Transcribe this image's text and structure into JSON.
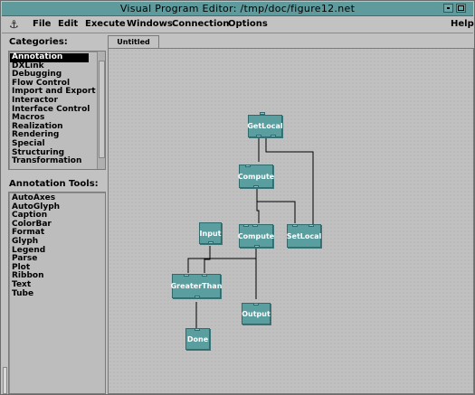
{
  "window": {
    "title": "Visual Program Editor: /tmp/doc/figure12.net"
  },
  "menu": {
    "file": "File",
    "edit": "Edit",
    "execute": "Execute",
    "windows": "Windows",
    "connection": "Connection",
    "options": "Options",
    "help": "Help"
  },
  "categories": {
    "label": "Categories:",
    "items": [
      "Annotation",
      "DXLink",
      "Debugging",
      "Flow Control",
      "Import and Export",
      "Interactor",
      "Interface Control",
      "Macros",
      "Realization",
      "Rendering",
      "Special",
      "Structuring",
      "Transformation"
    ],
    "selected": "Annotation"
  },
  "tools": {
    "label": "Annotation Tools:",
    "items": [
      "AutoAxes",
      "AutoGlyph",
      "Caption",
      "ColorBar",
      "Format",
      "Glyph",
      "Legend",
      "Parse",
      "Plot",
      "Ribbon",
      "Text",
      "Tube"
    ]
  },
  "tab": {
    "label": "Untitled"
  },
  "nodes": {
    "getlocal": "GetLocal",
    "compute1": "Compute",
    "input": "Input",
    "compute2": "Compute",
    "setlocal": "SetLocal",
    "greaterthan": "GreaterThan",
    "output": "Output",
    "done": "Done"
  },
  "colors": {
    "module": "#5a9ea0",
    "titlebar": "#5f9a9c"
  }
}
